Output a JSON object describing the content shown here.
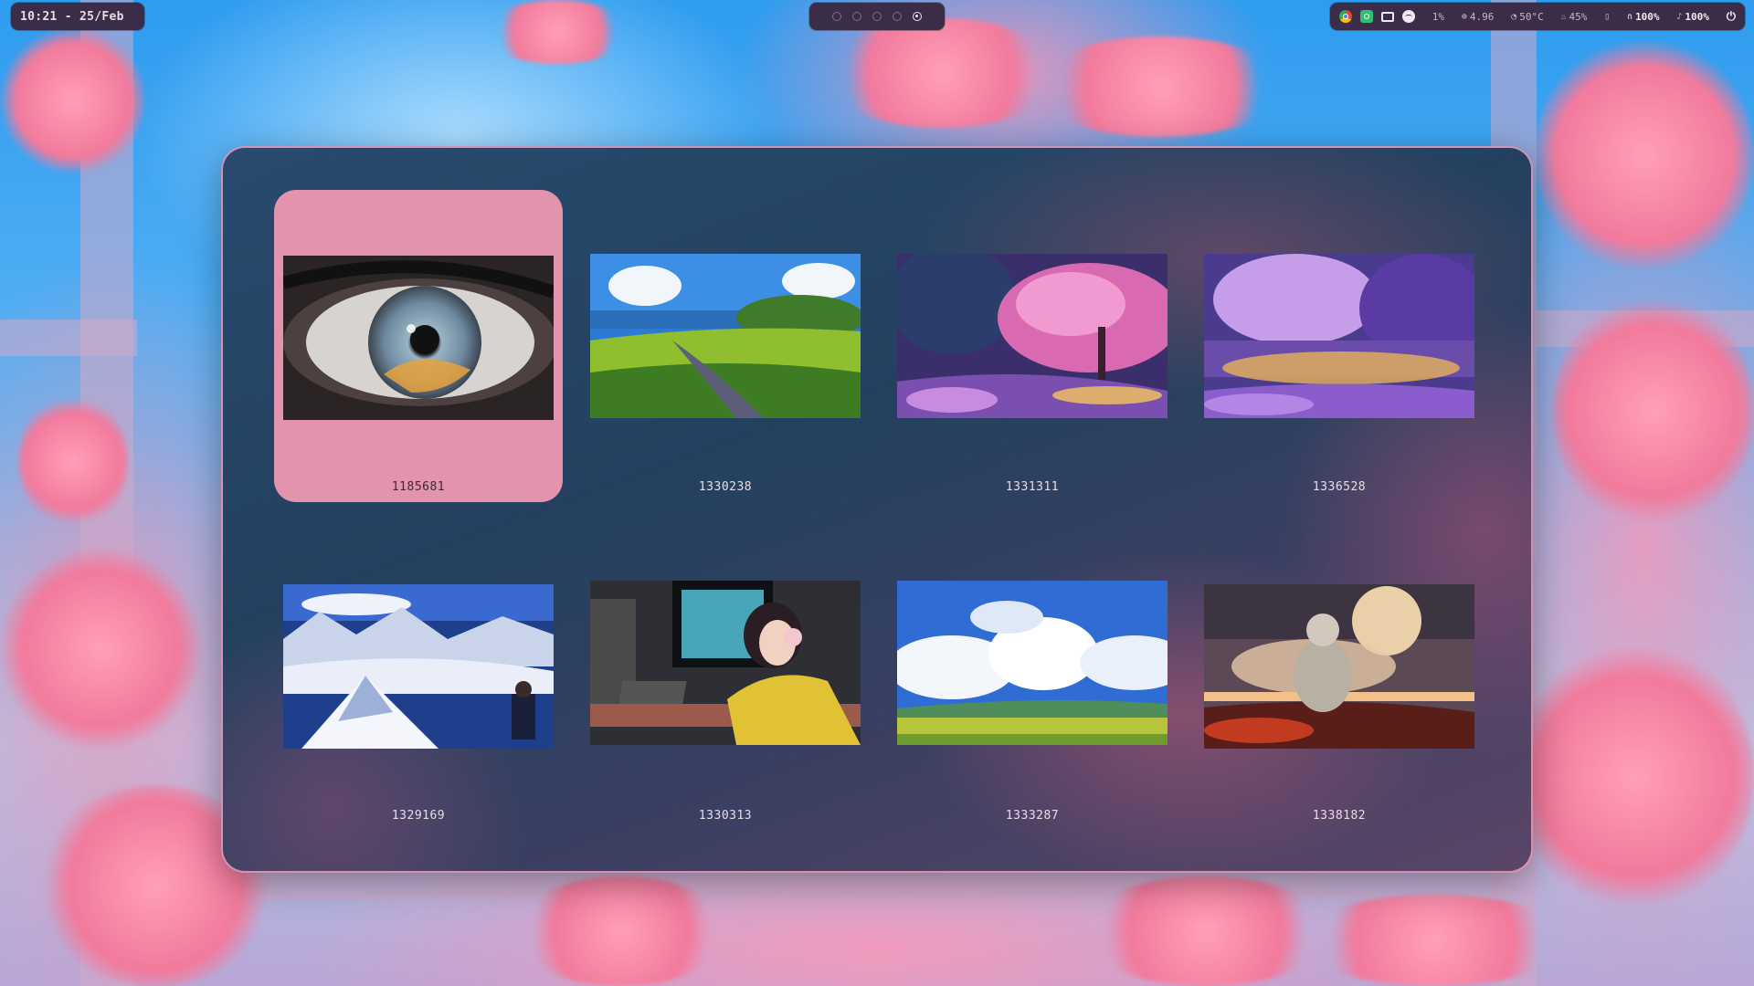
{
  "topbar": {
    "clock": "10:21 - 25/Feb",
    "workspaces": [
      {
        "icon": "workspace-dot-icon",
        "active": false
      },
      {
        "icon": "workspace-dot-icon",
        "active": false
      },
      {
        "icon": "workspace-dot-icon",
        "active": false
      },
      {
        "icon": "workspace-dot-icon",
        "active": false
      },
      {
        "icon": "workspace-dot-active-icon",
        "active": true
      }
    ],
    "tray_icons": [
      "chrome-icon",
      "green-app-icon",
      "monitor-icon",
      "spotify-icon"
    ],
    "stats": {
      "cpu": "1%",
      "ram": "4.96",
      "temp": "50°C",
      "brightness": "45%",
      "headphones": "100%",
      "microphone": "100%"
    },
    "power_icon": "power-icon"
  },
  "wallpaper_picker": {
    "selected_index": 0,
    "items": [
      {
        "label": "1185681",
        "thumbnail": "eye-closeup"
      },
      {
        "label": "1330238",
        "thumbnail": "green-meadow-path"
      },
      {
        "label": "1331311",
        "thumbnail": "pink-blossom-tree"
      },
      {
        "label": "1336528",
        "thumbnail": "purple-forest"
      },
      {
        "label": "1329169",
        "thumbnail": "snowy-mountains"
      },
      {
        "label": "1330313",
        "thumbnail": "girl-at-desk"
      },
      {
        "label": "1333287",
        "thumbnail": "cloudy-field"
      },
      {
        "label": "1338182",
        "thumbnail": "astronaut-moon"
      }
    ]
  },
  "colors": {
    "bar_bg": "#3b2c47",
    "selection": "#e493ad",
    "panel_border": "#eba0c3"
  }
}
